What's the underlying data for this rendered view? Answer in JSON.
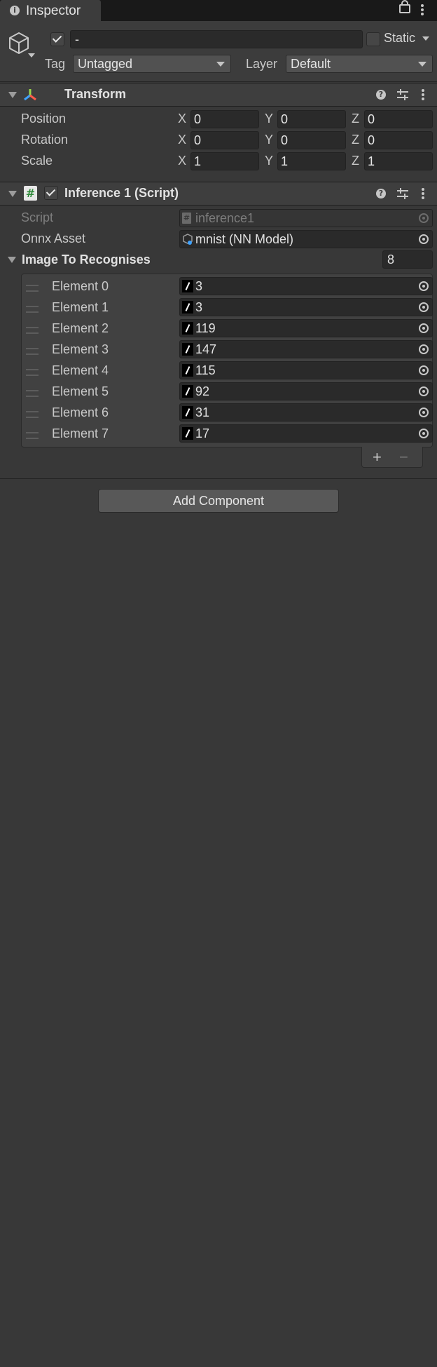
{
  "tab": {
    "title": "Inspector"
  },
  "gameobject": {
    "name": "-",
    "active": true,
    "static_label": "Static",
    "tag_label": "Tag",
    "tag_value": "Untagged",
    "layer_label": "Layer",
    "layer_value": "Default"
  },
  "transform": {
    "title": "Transform",
    "rows": [
      {
        "label": "Position",
        "x": "0",
        "y": "0",
        "z": "0"
      },
      {
        "label": "Rotation",
        "x": "0",
        "y": "0",
        "z": "0"
      },
      {
        "label": "Scale",
        "x": "1",
        "y": "1",
        "z": "1"
      }
    ],
    "axis": {
      "x": "X",
      "y": "Y",
      "z": "Z"
    }
  },
  "script_component": {
    "title": "Inference 1 (Script)",
    "enabled": true,
    "script_label": "Script",
    "script_value": "inference1",
    "onnx_label": "Onnx Asset",
    "onnx_value": "mnist (NN Model)",
    "list_label": "Image To Recognises",
    "list_size": "8",
    "elements": [
      {
        "label": "Element 0",
        "value": "3"
      },
      {
        "label": "Element 1",
        "value": "3"
      },
      {
        "label": "Element 2",
        "value": "119"
      },
      {
        "label": "Element 3",
        "value": "147"
      },
      {
        "label": "Element 4",
        "value": "115"
      },
      {
        "label": "Element 5",
        "value": "92"
      },
      {
        "label": "Element 6",
        "value": "31"
      },
      {
        "label": "Element 7",
        "value": "17"
      }
    ],
    "add_symbol": "+",
    "remove_symbol": "−"
  },
  "add_component_label": "Add Component"
}
